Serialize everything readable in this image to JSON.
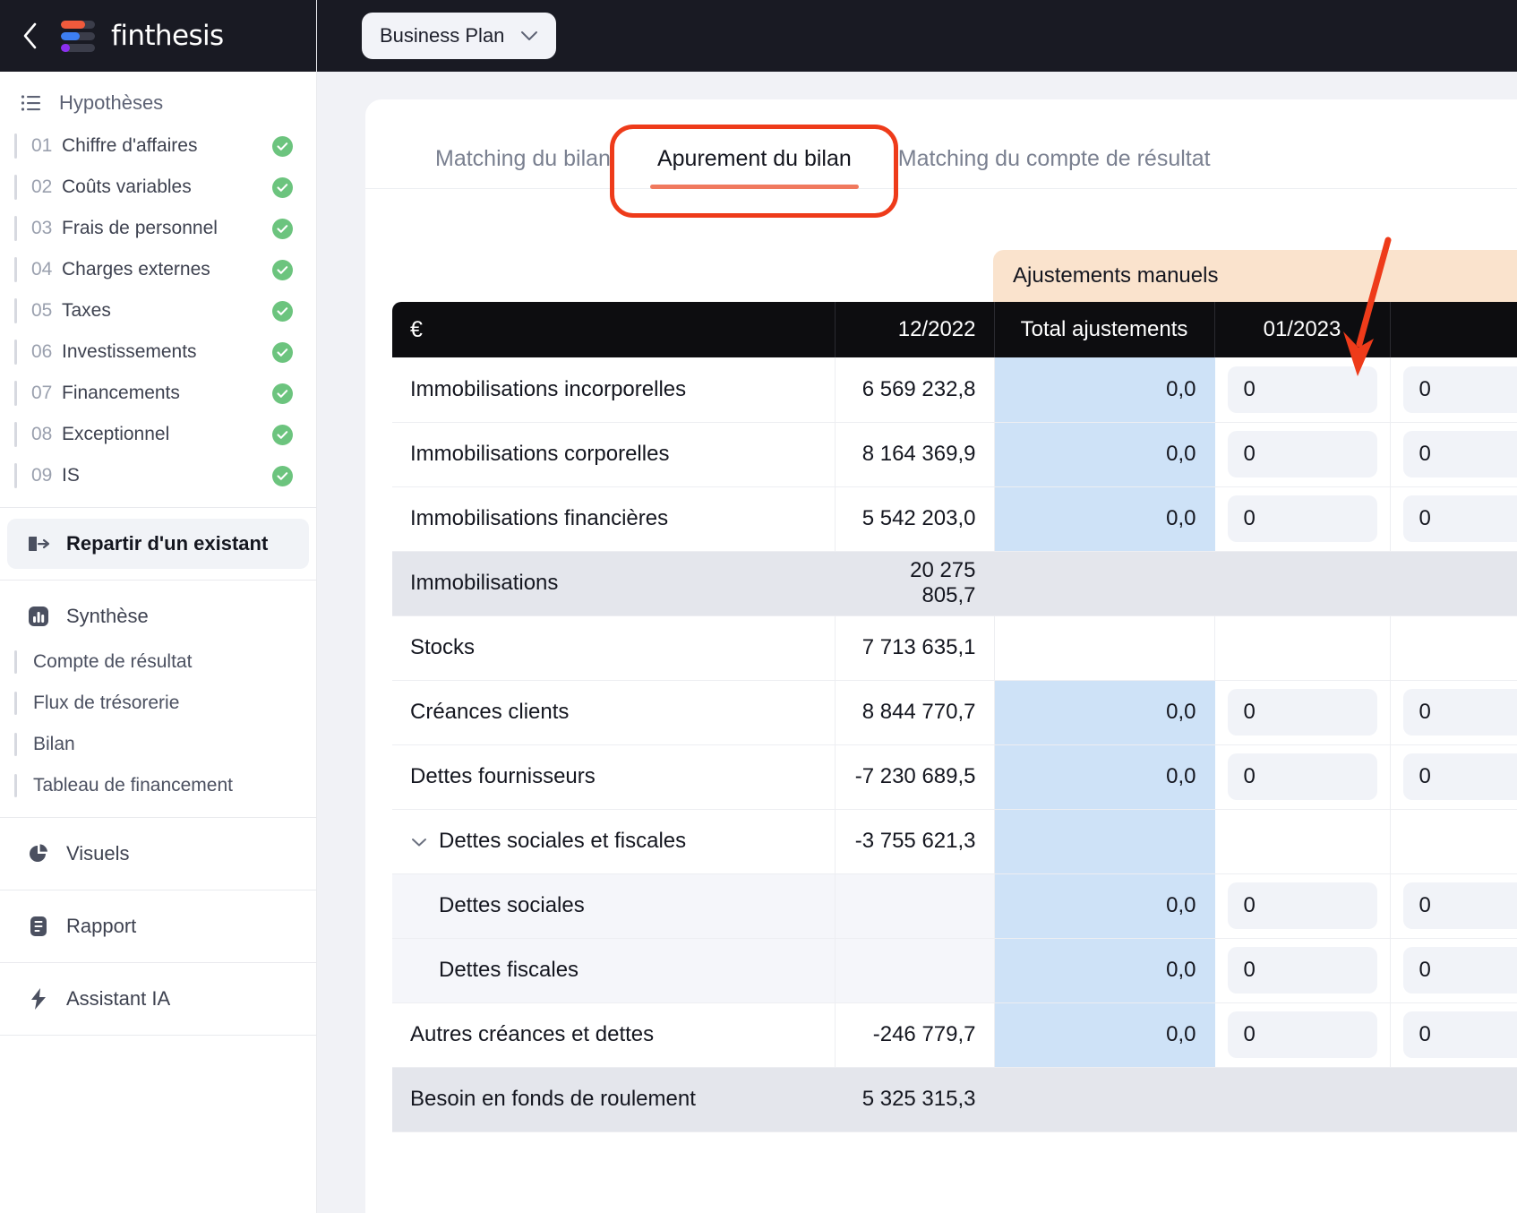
{
  "brand": {
    "name": "finthesis",
    "back_icon": "chevron-left-icon",
    "logo_icon": "finthesis-logo-icon"
  },
  "topbar": {
    "plan_label": "Business Plan",
    "chevron_icon": "chevron-down-icon"
  },
  "sidebar": {
    "hypotheses_title": "Hypothèses",
    "hypotheses_icon": "list-icon",
    "hypotheses": [
      {
        "num": "01",
        "label": "Chiffre d'affaires",
        "status": "done"
      },
      {
        "num": "02",
        "label": "Coûts variables",
        "status": "done"
      },
      {
        "num": "03",
        "label": "Frais de personnel",
        "status": "done"
      },
      {
        "num": "04",
        "label": "Charges externes",
        "status": "done"
      },
      {
        "num": "05",
        "label": "Taxes",
        "status": "done"
      },
      {
        "num": "06",
        "label": "Investissements",
        "status": "done"
      },
      {
        "num": "07",
        "label": "Financements",
        "status": "done"
      },
      {
        "num": "08",
        "label": "Exceptionnel",
        "status": "done"
      },
      {
        "num": "09",
        "label": "IS",
        "status": "done"
      }
    ],
    "repartir": {
      "label": "Repartir d'un existant",
      "icon": "export-arrow-icon"
    },
    "synthese": {
      "label": "Synthèse",
      "icon": "bar-chart-icon"
    },
    "synthese_items": [
      {
        "label": "Compte de résultat"
      },
      {
        "label": "Flux de trésorerie"
      },
      {
        "label": "Bilan"
      },
      {
        "label": "Tableau de financement"
      }
    ],
    "visuels": {
      "label": "Visuels",
      "icon": "pie-chart-icon"
    },
    "rapport": {
      "label": "Rapport",
      "icon": "document-icon"
    },
    "assistant": {
      "label": "Assistant IA",
      "icon": "lightning-bolt-icon"
    }
  },
  "tabs": [
    {
      "label": "Matching du bilan",
      "active": false
    },
    {
      "label": "Apurement du bilan",
      "active": true
    },
    {
      "label": "Matching du compte de résultat",
      "active": false
    }
  ],
  "table": {
    "adjustments_banner": "Ajustements manuels",
    "headers": {
      "label": "€",
      "period": "12/2022",
      "total_adj": "Total ajustements",
      "month1": "01/2023",
      "month2": ""
    },
    "rows": [
      {
        "label": "Immobilisations incorporelles",
        "period": "6 569 232,8",
        "adj": "0,0",
        "m1": "0",
        "m2": "0",
        "type": "normal",
        "has_adj": true
      },
      {
        "label": "Immobilisations corporelles",
        "period": "8 164 369,9",
        "adj": "0,0",
        "m1": "0",
        "m2": "0",
        "type": "normal",
        "has_adj": true
      },
      {
        "label": "Immobilisations financières",
        "period": "5 542 203,0",
        "adj": "0,0",
        "m1": "0",
        "m2": "0",
        "type": "normal",
        "has_adj": true
      },
      {
        "label": "Immobilisations",
        "period": "20 275 805,7",
        "adj": "",
        "m1": "",
        "m2": "",
        "type": "subtotal",
        "has_adj": false
      },
      {
        "label": "Stocks",
        "period": "7 713 635,1",
        "adj": "",
        "m1": "",
        "m2": "",
        "type": "normal",
        "has_adj": false
      },
      {
        "label": "Créances clients",
        "period": "8 844 770,7",
        "adj": "0,0",
        "m1": "0",
        "m2": "0",
        "type": "normal",
        "has_adj": true
      },
      {
        "label": "Dettes fournisseurs",
        "period": "-7 230 689,5",
        "adj": "0,0",
        "m1": "0",
        "m2": "0",
        "type": "normal",
        "has_adj": true
      },
      {
        "label": "Dettes sociales et fiscales",
        "period": "-3 755 621,3",
        "adj": "",
        "m1": "",
        "m2": "",
        "type": "expandable",
        "has_adj": true
      },
      {
        "label": "Dettes sociales",
        "period": "",
        "adj": "0,0",
        "m1": "0",
        "m2": "0",
        "type": "child",
        "has_adj": true
      },
      {
        "label": "Dettes fiscales",
        "period": "",
        "adj": "0,0",
        "m1": "0",
        "m2": "0",
        "type": "child",
        "has_adj": true
      },
      {
        "label": "Autres créances et dettes",
        "period": "-246 779,7",
        "adj": "0,0",
        "m1": "0",
        "m2": "0",
        "type": "normal",
        "has_adj": true
      },
      {
        "label": "Besoin en fonds de roulement",
        "period": "5 325 315,3",
        "adj": "",
        "m1": "",
        "m2": "",
        "type": "subtotal",
        "has_adj": false
      }
    ]
  },
  "annotations": {
    "tab_ring_color": "#ee3b1a",
    "arrow_color": "#ee3b1a",
    "arrow_target": "01/2023"
  },
  "colors": {
    "accent": "#f0795e",
    "adjust_banner_bg": "#fae3cd",
    "adjust_cell_bg": "#cee2f7",
    "header_bg": "#0d0d10",
    "subtotal_bg": "#e4e6ec",
    "check_green": "#6cc47e"
  }
}
